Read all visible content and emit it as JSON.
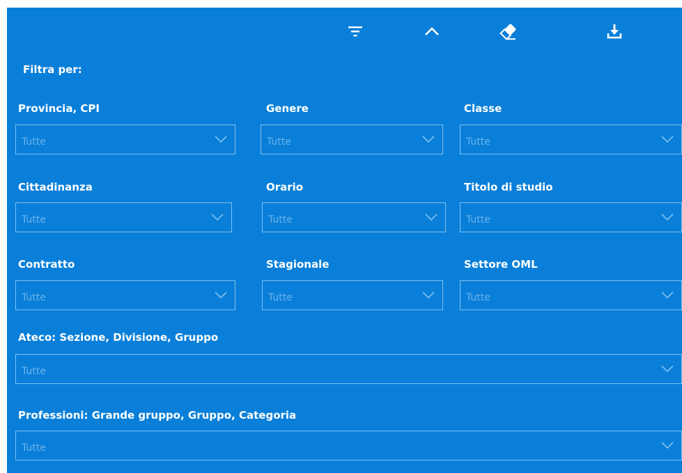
{
  "toolbar": {
    "icons": [
      "filter-icon",
      "chevron-up-icon",
      "eraser-icon",
      "download-icon"
    ]
  },
  "filter": {
    "header": "Filtra per:",
    "fields": {
      "provincia": {
        "label": "Provincia, CPI",
        "value": "Tutte"
      },
      "genere": {
        "label": "Genere",
        "value": "Tutte"
      },
      "classe": {
        "label": "Classe",
        "value": "Tutte"
      },
      "cittadinanza": {
        "label": "Cittadinanza",
        "value": "Tutte"
      },
      "orario": {
        "label": "Orario",
        "value": "Tutte"
      },
      "titolo": {
        "label": "Titolo di studio",
        "value": "Tutte"
      },
      "contratto": {
        "label": "Contratto",
        "value": "Tutte"
      },
      "stagionale": {
        "label": "Stagionale",
        "value": "Tutte"
      },
      "settore": {
        "label": "Settore OML",
        "value": "Tutte"
      },
      "ateco": {
        "label": "Ateco: Sezione, Divisione, Gruppo",
        "value": "Tutte"
      },
      "professioni": {
        "label": "Professioni: Grande gruppo, Gruppo, Categoria",
        "value": "Tutte"
      }
    }
  },
  "colors": {
    "panel_bg": "#0a7fd9",
    "border": "#7fc0f0",
    "placeholder_text": "#6ab3ea",
    "label_text": "#ffffff"
  }
}
